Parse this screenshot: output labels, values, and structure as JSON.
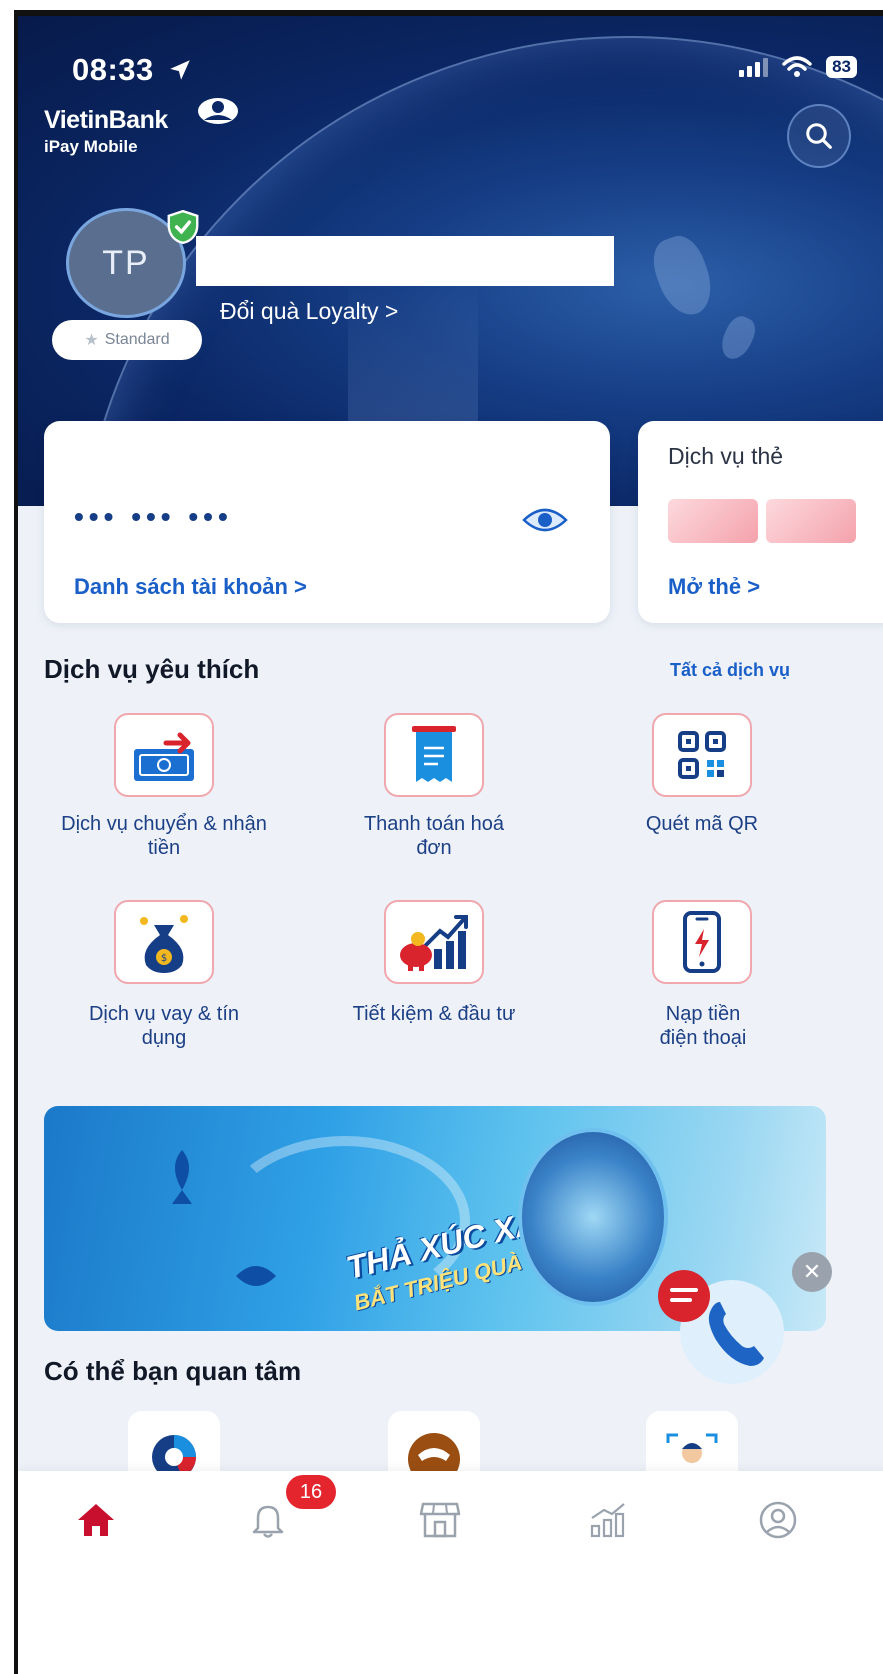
{
  "status_bar": {
    "time": "08:33",
    "battery": "83"
  },
  "brand": {
    "name": "VietinBank",
    "product": "iPay Mobile"
  },
  "profile": {
    "initials": "TP",
    "loyalty_link": "Đổi quà Loyalty >",
    "tier": "Standard"
  },
  "account_card": {
    "masked_balance": "••• ••• •••",
    "accounts_link": "Danh sách tài khoản >"
  },
  "card_service": {
    "title": "Dịch vụ thẻ",
    "open_link": "Mở thẻ >"
  },
  "favorites": {
    "title": "Dịch vụ yêu thích",
    "all_link": "Tất cả dịch vụ",
    "items": [
      {
        "label": "Dịch vụ chuyển & nhận tiền",
        "icon": "money-transfer-icon"
      },
      {
        "label": "Thanh toán hoá đơn",
        "icon": "bill-payment-icon"
      },
      {
        "label": "Quét mã QR",
        "icon": "qr-code-icon"
      },
      {
        "label": "Dịch vụ vay & tín dụng",
        "icon": "loan-bag-icon"
      },
      {
        "label": "Tiết kiệm & đầu tư",
        "icon": "savings-chart-icon"
      },
      {
        "label": "Nạp tiền điện thoại",
        "icon": "phone-topup-icon"
      }
    ]
  },
  "banner": {
    "line1": "THẢ XÚC XẮC",
    "line2": "BẮT TRIỆU QUÀ"
  },
  "suggestions": {
    "title": "Có thể bạn quan tâm"
  },
  "nav": {
    "items": [
      "home-icon",
      "bell-icon",
      "store-icon",
      "chart-icon",
      "user-icon"
    ],
    "notification_count": "16"
  },
  "colors": {
    "primary": "#163e86",
    "link": "#1a5fc8",
    "accent_red": "#c8102e",
    "badge": "#e4252e"
  }
}
